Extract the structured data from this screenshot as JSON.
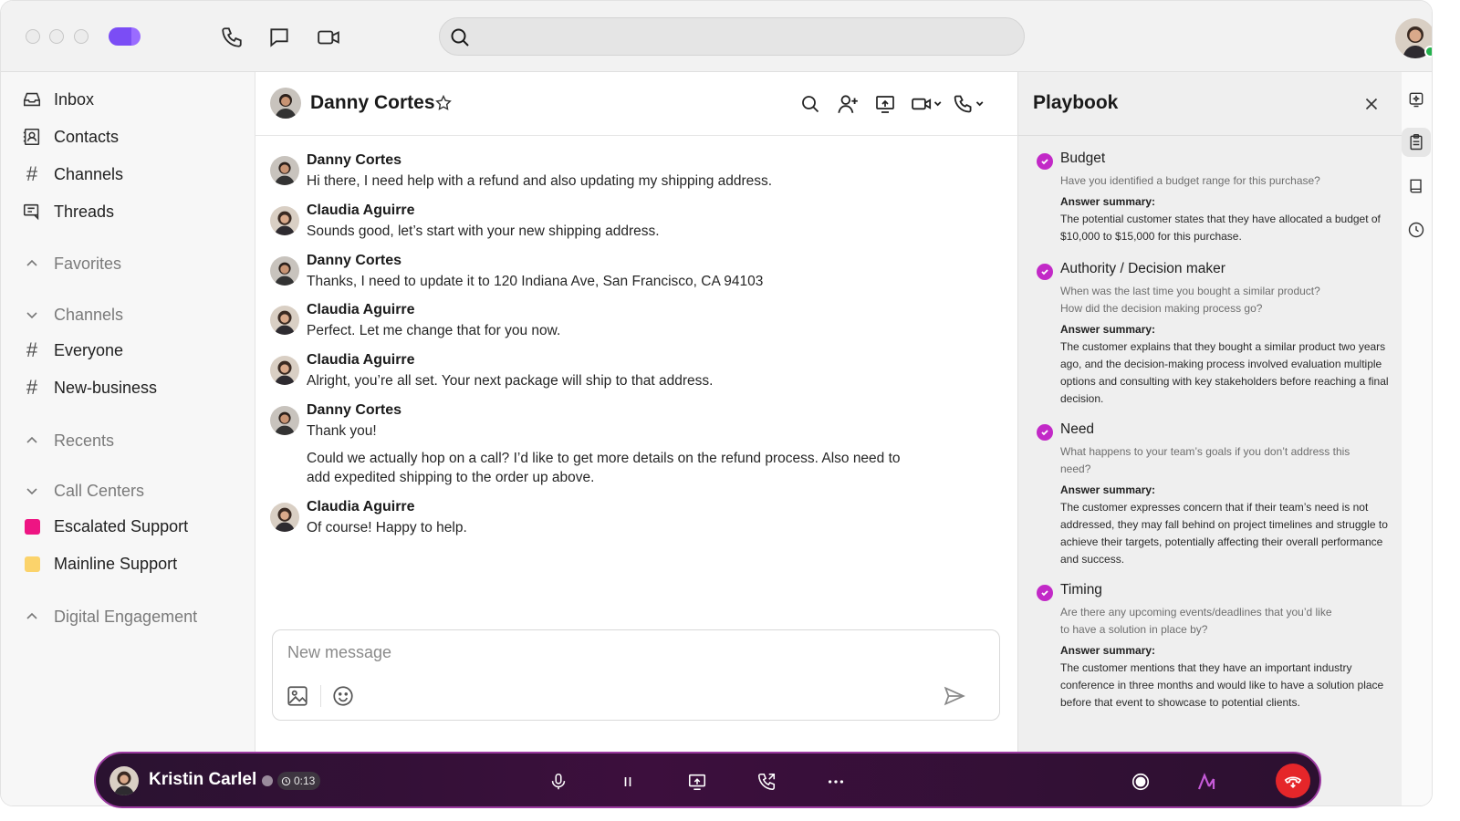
{
  "colors": {
    "accent_purple": "#c229c7",
    "escalated_support": "#ee1583",
    "mainline_support": "#fbd36b",
    "online": "#23b14d",
    "hangup": "#e5262a"
  },
  "topbar": {
    "icons": [
      "phone-icon",
      "chat-bubble-icon",
      "video-icon"
    ],
    "search_placeholder": ""
  },
  "sidebar": {
    "nav": [
      {
        "label": "Inbox",
        "icon": "inbox-icon"
      },
      {
        "label": "Contacts",
        "icon": "contacts-icon"
      },
      {
        "label": "Channels",
        "icon": "hash-icon"
      },
      {
        "label": "Threads",
        "icon": "threads-icon"
      }
    ],
    "favorites": "Favorites",
    "channels_section": "Channels",
    "channels": [
      "Everyone",
      "New-business"
    ],
    "recents": "Recents",
    "call_centers": "Call Centers",
    "call_center_items": [
      "Escalated Support",
      "Mainline Support"
    ],
    "digital_engagement": "Digital Engagement"
  },
  "chat": {
    "contact_name": "Danny Cortes",
    "messages": [
      {
        "sender": "Danny Cortes",
        "text": "Hi there, I need help with a refund and also updating my shipping address."
      },
      {
        "sender": "Claudia Aguirre",
        "text": "Sounds good, let’s start with your new shipping address."
      },
      {
        "sender": "Danny Cortes",
        "text": "Thanks, I need to update it to 120 Indiana Ave, San Francisco, CA 94103"
      },
      {
        "sender": "Claudia Aguirre",
        "text": "Perfect. Let me change that for you now."
      },
      {
        "sender": "Claudia Aguirre",
        "text": "Alright, you’re all set. Your next package will ship to that address."
      },
      {
        "sender": "Danny Cortes",
        "text": "Thank you!",
        "text2": "Could we actually hop on a call? I’d like to get more details on the refund process. Also need to add expedited shipping to the order up above."
      },
      {
        "sender": "Claudia Aguirre",
        "text": "Of course! Happy to help."
      }
    ],
    "composer_placeholder": "New message"
  },
  "playbook": {
    "title": "Playbook",
    "answer_label": "Answer summary:",
    "items": [
      {
        "title": "Budget",
        "question": "Have you identified a budget range for this purchase?",
        "answer": "The potential customer states that they have allocated a budget of $10,000 to $15,000 for this purchase."
      },
      {
        "title": "Authority / Decision maker",
        "question": "When was the last time you bought a similar product? How did the decision making process go?",
        "answer": "The customer explains that they bought a similar product two years ago, and the decision-making process involved evaluation multiple options and consulting with key stakeholders before reaching a final decision."
      },
      {
        "title": "Need",
        "question": "What happens to your team’s goals if you don’t address this need?",
        "answer": "The customer expresses concern that if their team’s need is not addressed, they may fall behind on project timelines and struggle to achieve their targets, potentially affecting their overall performance and success."
      },
      {
        "title": "Timing",
        "question": "Are there any upcoming events/deadlines that you’d like to have a solution in place by?",
        "answer": "The customer mentions that they have an important industry conference in three months and would like to have a solution place before that event to showcase to potential clients."
      }
    ]
  },
  "callbar": {
    "caller_name": "Kristin Carlel",
    "timer": "0:13"
  }
}
